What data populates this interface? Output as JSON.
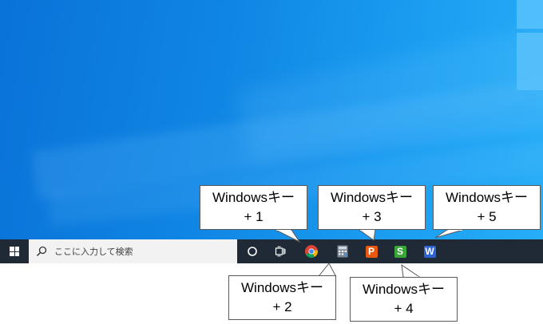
{
  "taskbar": {
    "search_placeholder": "ここに入力して検索",
    "pinned_apps": [
      {
        "name": "Google Chrome",
        "icon": "chrome-icon"
      },
      {
        "name": "Calculator",
        "icon": "calculator-icon"
      },
      {
        "name": "WPS Presentation",
        "icon": "wps-presentation-icon",
        "letter": "P",
        "color": "#e8590f"
      },
      {
        "name": "WPS Spreadsheets",
        "icon": "wps-spreadsheets-icon",
        "letter": "S",
        "color": "#3aa639"
      },
      {
        "name": "WPS Writer",
        "icon": "wps-writer-icon",
        "letter": "W",
        "color": "#2d63d2"
      }
    ]
  },
  "callouts": [
    {
      "line1": "Windowsキー",
      "line2": "+ 1"
    },
    {
      "line1": "Windowsキー",
      "line2": "+ 2"
    },
    {
      "line1": "Windowsキー",
      "line2": "+ 3"
    },
    {
      "line1": "Windowsキー",
      "line2": "+ 4"
    },
    {
      "line1": "Windowsキー",
      "line2": "+ 5"
    }
  ],
  "colors": {
    "taskbar": "#1f2a36",
    "desktop": "#0f86e4",
    "search_box": "#f2f2f2"
  }
}
